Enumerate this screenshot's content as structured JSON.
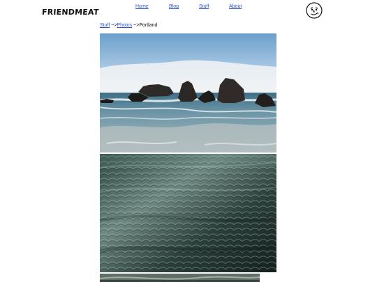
{
  "header": {
    "logo_text": "FRIENDMEAT",
    "nav": [
      {
        "label": "Home"
      },
      {
        "label": "Blog"
      },
      {
        "label": "Stuff"
      },
      {
        "label": "About"
      }
    ]
  },
  "breadcrumb": {
    "parts": [
      "Stuff",
      " ~>",
      "Photos",
      " ~>Portland"
    ]
  },
  "photos": [
    {
      "name": "coastal-rocks-photo"
    },
    {
      "name": "eroded-rock-texture-photo"
    },
    {
      "name": "partial-photo"
    }
  ],
  "colors": {
    "link": "#2b55d8",
    "text": "#111111",
    "background": "#ffffff"
  }
}
